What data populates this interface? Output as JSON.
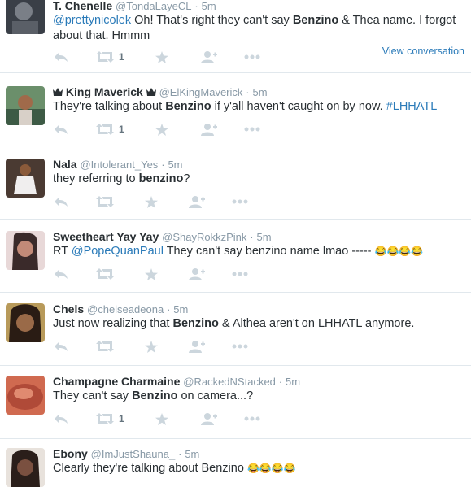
{
  "tweets": [
    {
      "name": "T. Chenelle",
      "handle": "@TondaLayeCL",
      "time": "5m",
      "mention": "@prettynicolek",
      "text_a": " Oh! That's right they can't say ",
      "bold": "Benzino",
      "text_b": " & Thea name. I forgot",
      "line2": "about that. Hmmm",
      "retweets": "1",
      "view_conversation": "View conversation",
      "avatar_color": "#3a3f47"
    },
    {
      "name": "King Maverick",
      "handle": "@ElKingMaverick",
      "time": "5m",
      "text_a": "They're talking about ",
      "bold": "Benzino",
      "text_b": " if y'all haven't caught on by now. ",
      "hashtag": "#LHHATL",
      "retweets": "1",
      "avatar_color": "#4a7a5a"
    },
    {
      "name": "Nala",
      "handle": "@Intolerant_Yes",
      "time": "5m",
      "text_a": "they referring to ",
      "bold": "benzino",
      "text_b": "?",
      "avatar_color": "#5b4a42"
    },
    {
      "name": "Sweetheart Yay Yay",
      "handle": "@ShayRokkzPink",
      "time": "5m",
      "text_a": "RT ",
      "mention": "@PopeQuanPaul",
      "text_b": " They can't say benzino name lmao ----- ",
      "emoji": "😂😂😂😂",
      "avatar_color": "#c9a3a0"
    },
    {
      "name": "Chels",
      "handle": "@chelseadeona",
      "time": "5m",
      "text_a": "Just now realizing that ",
      "bold": "Benzino",
      "text_b": " & Althea aren't on LHHATL anymore.",
      "avatar_color": "#8a6a3a"
    },
    {
      "name": "Champagne Charmaine",
      "handle": "@RackedNStacked",
      "time": "5m",
      "text_a": "They can't say ",
      "bold": "Benzino",
      "text_b": " on camera...?",
      "retweets": "1",
      "avatar_color": "#c0604a"
    },
    {
      "name": "Ebony",
      "handle": "@ImJustShauna_",
      "time": "5m",
      "text_a": "Clearly they're talking about Benzino ",
      "emoji": "😂😂😂😂",
      "avatar_color": "#3b2e2a"
    }
  ],
  "dot": "·",
  "icons": {
    "reply": "reply-icon",
    "retweet": "retweet-icon",
    "favorite": "star-icon",
    "follow": "follow-icon",
    "more": "more-icon"
  },
  "colors": {
    "link": "#2b7bb9",
    "muted": "#8899a6",
    "icon": "#ccd6dd",
    "border": "#e1e8ed"
  }
}
